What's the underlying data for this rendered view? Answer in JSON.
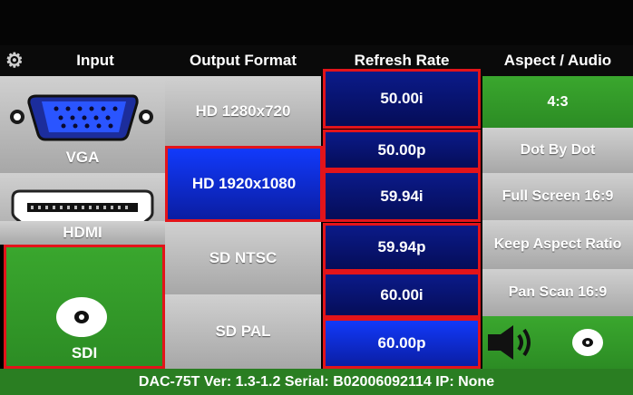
{
  "header": {
    "input": "Input",
    "output_format": "Output Format",
    "refresh_rate": "Refresh Rate",
    "aspect_audio": "Aspect / Audio"
  },
  "inputs": {
    "vga": "VGA",
    "hdmi": "HDMI",
    "sdi": "SDI",
    "selected": "SDI"
  },
  "output_formats": [
    "HD 1280x720",
    "HD 1920x1080",
    "SD NTSC",
    "SD PAL"
  ],
  "selected_output_format": "HD 1920x1080",
  "refresh_rates": [
    "50.00i",
    "50.00p",
    "59.94i",
    "59.94p",
    "60.00i",
    "60.00p"
  ],
  "aspect_options": [
    "4:3",
    "Dot By Dot",
    "Full Screen 16:9",
    "Keep Aspect Ratio",
    "Pan Scan 16:9"
  ],
  "status_bar": "DAC-75T Ver: 1.3-1.2 Serial: B02006092114 IP: None",
  "colors": {
    "selection": "#e3141a",
    "green": "#3aa72e",
    "blue": "#123bff"
  }
}
